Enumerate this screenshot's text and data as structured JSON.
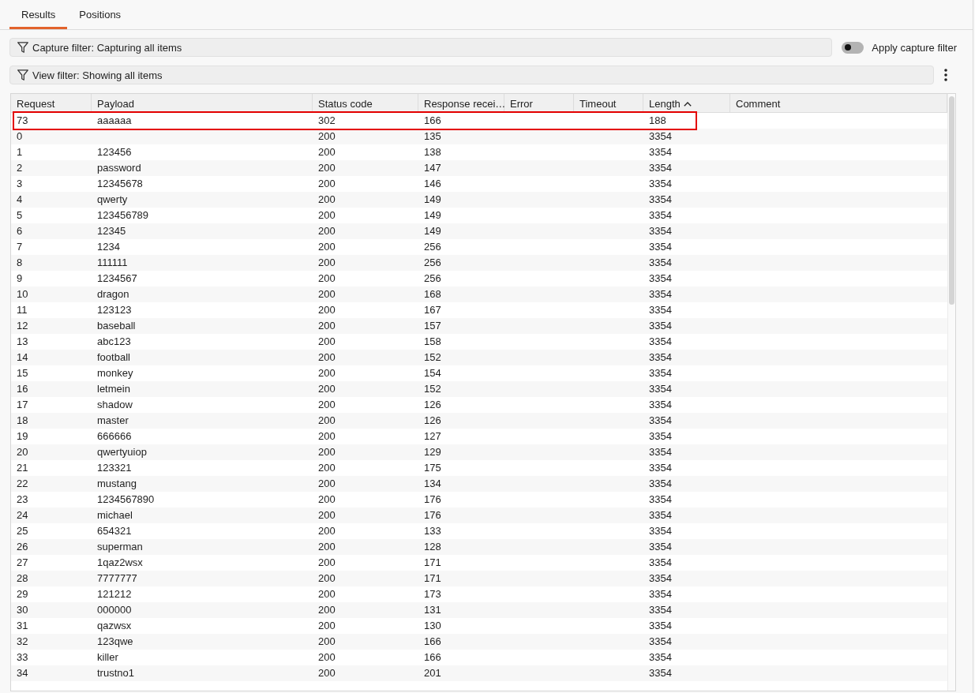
{
  "tabs": [
    {
      "label": "Results",
      "selected": true
    },
    {
      "label": "Positions",
      "selected": false
    }
  ],
  "capture_filter": {
    "text": "Capture filter: Capturing all items"
  },
  "apply_capture_filter": {
    "label": "Apply capture filter",
    "on": false
  },
  "view_filter": {
    "text": "View filter: Showing all items"
  },
  "table": {
    "columns": [
      {
        "label": "Request",
        "sorted": false
      },
      {
        "label": "Payload",
        "sorted": false
      },
      {
        "label": "Status code",
        "sorted": false
      },
      {
        "label": "Response recei…",
        "sorted": false
      },
      {
        "label": "Error",
        "sorted": false
      },
      {
        "label": "Timeout",
        "sorted": false
      },
      {
        "label": "Length",
        "sorted": true
      },
      {
        "label": "Comment",
        "sorted": false
      }
    ],
    "rows": [
      {
        "request": "73",
        "payload": "aaaaaa",
        "status_code": "302",
        "response_received": "166",
        "length": "188",
        "highlighted": true
      },
      {
        "request": "0",
        "status_code": "200",
        "response_received": "135",
        "length": "3354",
        "highlighted": false
      },
      {
        "request": "1",
        "payload": "123456",
        "status_code": "200",
        "response_received": "138",
        "length": "3354",
        "highlighted": false
      },
      {
        "request": "2",
        "payload": "password",
        "status_code": "200",
        "response_received": "147",
        "length": "3354",
        "highlighted": false
      },
      {
        "request": "3",
        "payload": "12345678",
        "status_code": "200",
        "response_received": "146",
        "length": "3354",
        "highlighted": false
      },
      {
        "request": "4",
        "payload": "qwerty",
        "status_code": "200",
        "response_received": "149",
        "length": "3354",
        "highlighted": false
      },
      {
        "request": "5",
        "payload": "123456789",
        "status_code": "200",
        "response_received": "149",
        "length": "3354",
        "highlighted": false
      },
      {
        "request": "6",
        "payload": "12345",
        "status_code": "200",
        "response_received": "149",
        "length": "3354",
        "highlighted": false
      },
      {
        "request": "7",
        "payload": "1234",
        "status_code": "200",
        "response_received": "256",
        "length": "3354",
        "highlighted": false
      },
      {
        "request": "8",
        "payload": "111111",
        "status_code": "200",
        "response_received": "256",
        "length": "3354",
        "highlighted": false
      },
      {
        "request": "9",
        "payload": "1234567",
        "status_code": "200",
        "response_received": "256",
        "length": "3354",
        "highlighted": false
      },
      {
        "request": "10",
        "payload": "dragon",
        "status_code": "200",
        "response_received": "168",
        "length": "3354",
        "highlighted": false
      },
      {
        "request": "11",
        "payload": "123123",
        "status_code": "200",
        "response_received": "167",
        "length": "3354",
        "highlighted": false
      },
      {
        "request": "12",
        "payload": "baseball",
        "status_code": "200",
        "response_received": "157",
        "length": "3354",
        "highlighted": false
      },
      {
        "request": "13",
        "payload": "abc123",
        "status_code": "200",
        "response_received": "158",
        "length": "3354",
        "highlighted": false
      },
      {
        "request": "14",
        "payload": "football",
        "status_code": "200",
        "response_received": "152",
        "length": "3354",
        "highlighted": false
      },
      {
        "request": "15",
        "payload": "monkey",
        "status_code": "200",
        "response_received": "154",
        "length": "3354",
        "highlighted": false
      },
      {
        "request": "16",
        "payload": "letmein",
        "status_code": "200",
        "response_received": "152",
        "length": "3354",
        "highlighted": false
      },
      {
        "request": "17",
        "payload": "shadow",
        "status_code": "200",
        "response_received": "126",
        "length": "3354",
        "highlighted": false
      },
      {
        "request": "18",
        "payload": "master",
        "status_code": "200",
        "response_received": "126",
        "length": "3354",
        "highlighted": false
      },
      {
        "request": "19",
        "payload": "666666",
        "status_code": "200",
        "response_received": "127",
        "length": "3354",
        "highlighted": false
      },
      {
        "request": "20",
        "payload": "qwertyuiop",
        "status_code": "200",
        "response_received": "129",
        "length": "3354",
        "highlighted": false
      },
      {
        "request": "21",
        "payload": "123321",
        "status_code": "200",
        "response_received": "175",
        "length": "3354",
        "highlighted": false
      },
      {
        "request": "22",
        "payload": "mustang",
        "status_code": "200",
        "response_received": "134",
        "length": "3354",
        "highlighted": false
      },
      {
        "request": "23",
        "payload": "1234567890",
        "status_code": "200",
        "response_received": "176",
        "length": "3354",
        "highlighted": false
      },
      {
        "request": "24",
        "payload": "michael",
        "status_code": "200",
        "response_received": "176",
        "length": "3354",
        "highlighted": false
      },
      {
        "request": "25",
        "payload": "654321",
        "status_code": "200",
        "response_received": "133",
        "length": "3354",
        "highlighted": false
      },
      {
        "request": "26",
        "payload": "superman",
        "status_code": "200",
        "response_received": "128",
        "length": "3354",
        "highlighted": false
      },
      {
        "request": "27",
        "payload": "1qaz2wsx",
        "status_code": "200",
        "response_received": "171",
        "length": "3354",
        "highlighted": false
      },
      {
        "request": "28",
        "payload": "7777777",
        "status_code": "200",
        "response_received": "171",
        "length": "3354",
        "highlighted": false
      },
      {
        "request": "29",
        "payload": "121212",
        "status_code": "200",
        "response_received": "173",
        "length": "3354",
        "highlighted": false
      },
      {
        "request": "30",
        "payload": "000000",
        "status_code": "200",
        "response_received": "131",
        "length": "3354",
        "highlighted": false
      },
      {
        "request": "31",
        "payload": "qazwsx",
        "status_code": "200",
        "response_received": "130",
        "length": "3354",
        "highlighted": false
      },
      {
        "request": "32",
        "payload": "123qwe",
        "status_code": "200",
        "response_received": "166",
        "length": "3354",
        "highlighted": false
      },
      {
        "request": "33",
        "payload": "killer",
        "status_code": "200",
        "response_received": "166",
        "length": "3354",
        "highlighted": false
      },
      {
        "request": "34",
        "payload": "trustno1",
        "status_code": "200",
        "response_received": "201",
        "length": "3354",
        "highlighted": false
      }
    ]
  }
}
